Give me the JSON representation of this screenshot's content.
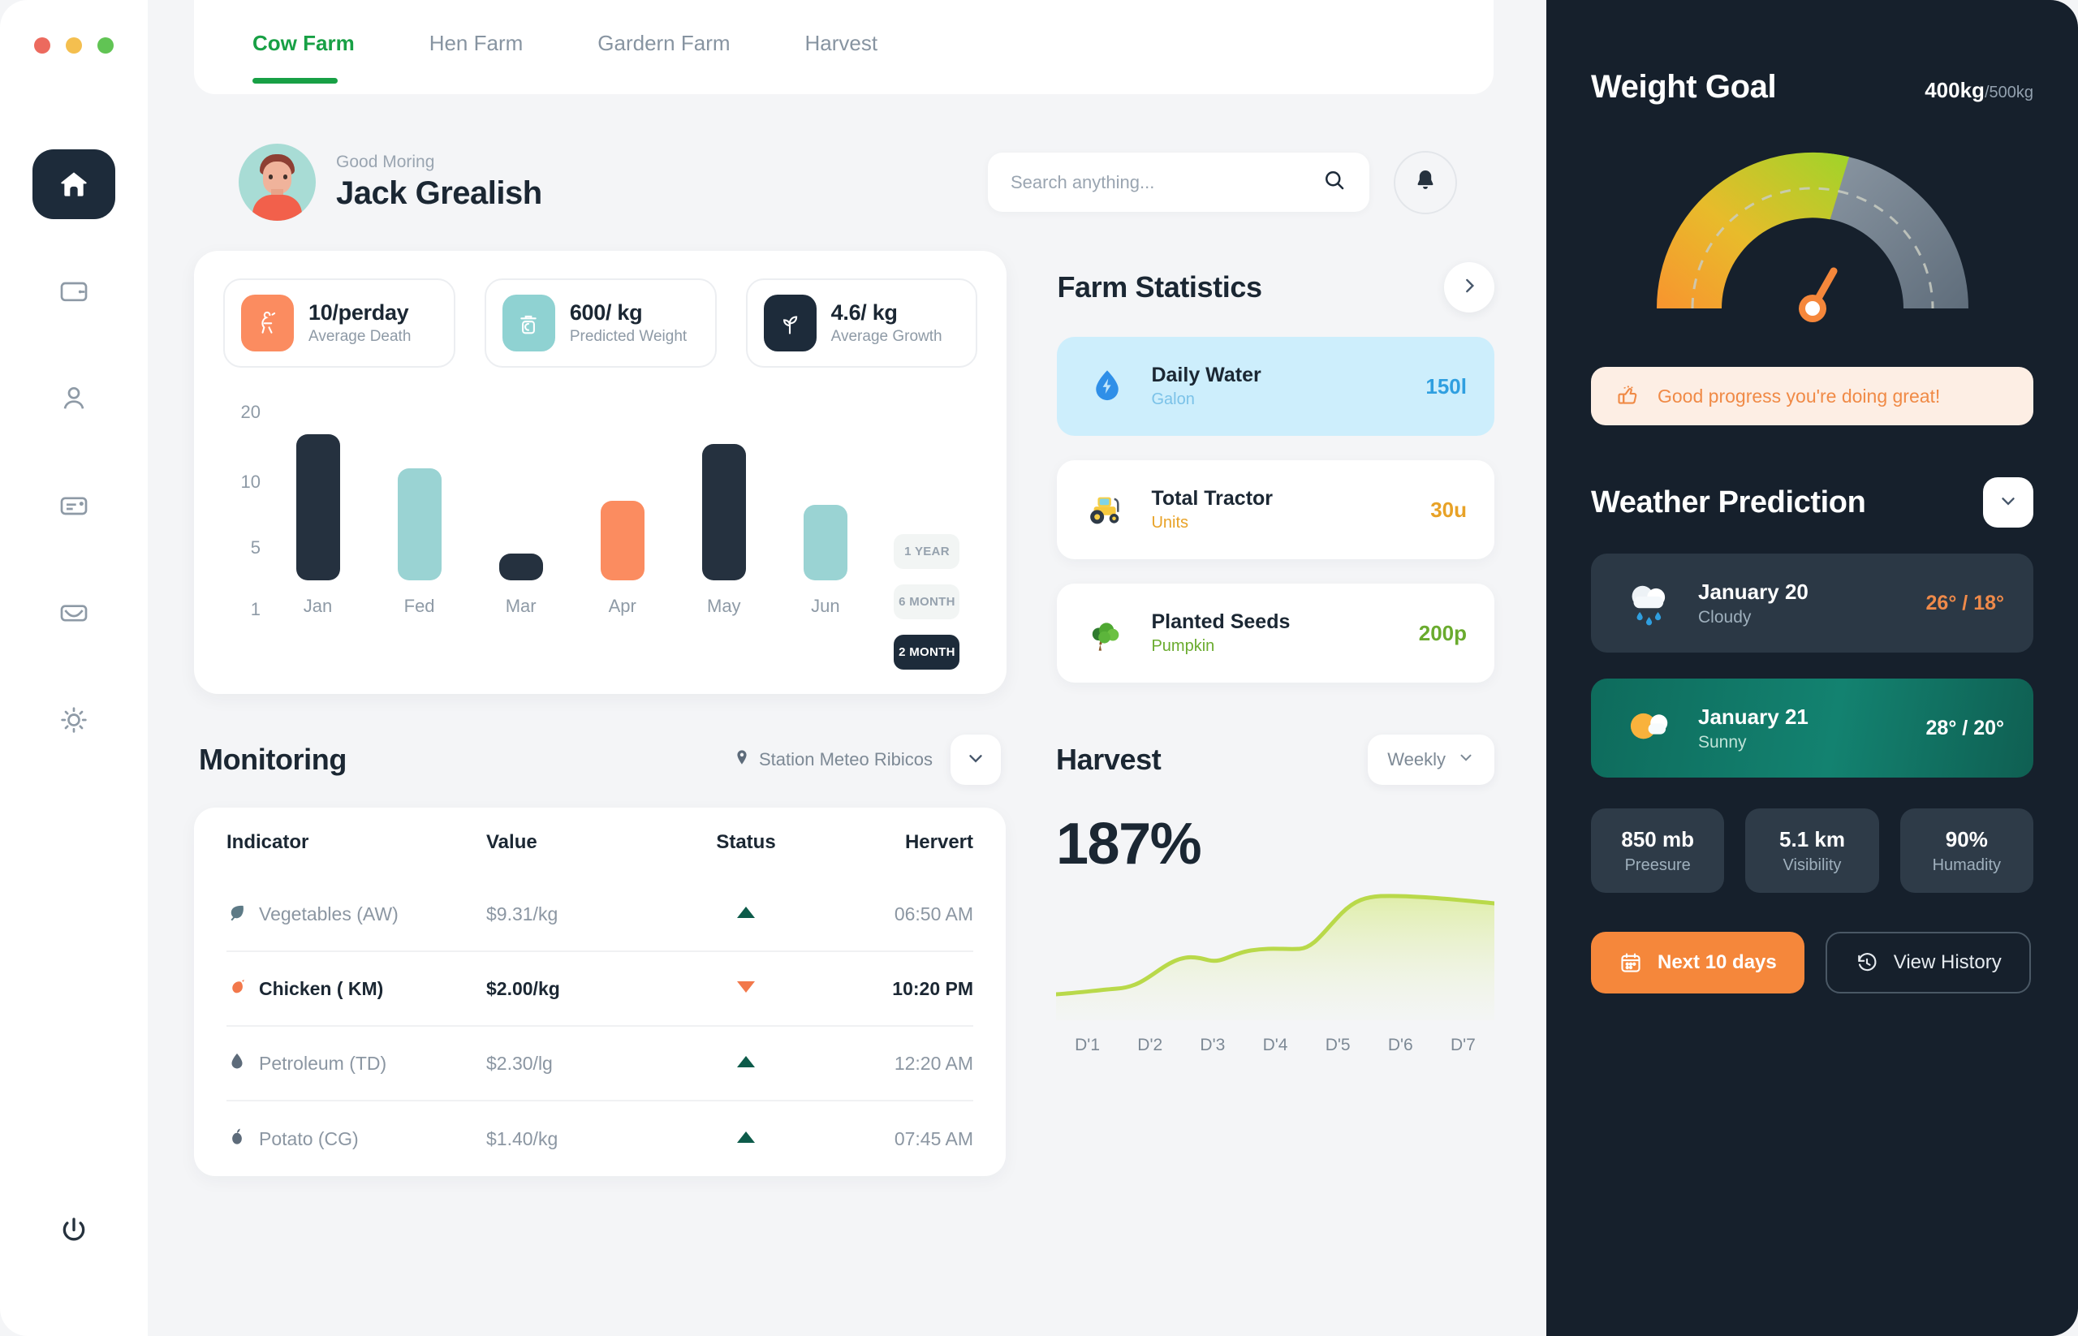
{
  "window": {
    "traffic_lights": [
      "close",
      "minimize",
      "maximize"
    ]
  },
  "sidebar": {
    "items": [
      {
        "icon": "home-icon",
        "active": true
      },
      {
        "icon": "wallet-icon",
        "active": false
      },
      {
        "icon": "user-icon",
        "active": false
      },
      {
        "icon": "card-message-icon",
        "active": false
      },
      {
        "icon": "envelope-icon",
        "active": false
      },
      {
        "icon": "brightness-sun-icon",
        "active": false
      }
    ],
    "power": "power-icon"
  },
  "tabs": [
    {
      "label": "Cow Farm",
      "active": true
    },
    {
      "label": "Hen Farm",
      "active": false
    },
    {
      "label": "Gardern Farm",
      "active": false
    },
    {
      "label": "Harvest",
      "active": false
    }
  ],
  "greeting": {
    "salutation": "Good Moring",
    "name": "Jack Grealish",
    "avatar": "user-avatar"
  },
  "search": {
    "placeholder": "Search anything...",
    "value": "",
    "icon": "search-icon"
  },
  "notifications": {
    "icon": "bell-icon"
  },
  "kpis": [
    {
      "value": "10/perday",
      "label": "Average Death",
      "icon": "chicken-icon",
      "color": "#fb8c60"
    },
    {
      "value": "600/ kg",
      "label": "Predicted Weight",
      "icon": "weight-scale-icon",
      "color": "#8fd2d2"
    },
    {
      "value": "4.6/ kg",
      "label": "Average Growth",
      "icon": "leaf-sprout-icon",
      "color": "#1d2b3a"
    }
  ],
  "chart_data": {
    "type": "bar",
    "title": "",
    "categories": [
      "Jan",
      "Fed",
      "Mar",
      "Apr",
      "May",
      "Jun"
    ],
    "values": [
      12,
      8.5,
      1.8,
      5.6,
      11.2,
      5.2
    ],
    "colors": [
      "#25313f",
      "#9ad3d3",
      "#25313f",
      "#fb8c60",
      "#25313f",
      "#9ad3d3"
    ],
    "ytick_labels": [
      "20",
      "10",
      "5",
      "1"
    ],
    "ytick_positions": [
      20,
      10,
      5,
      1
    ],
    "ylim": [
      0,
      20
    ],
    "xlabel": "",
    "ylabel": "",
    "grid": false,
    "legend": "none"
  },
  "chart_ranges": [
    {
      "label": "1 YEAR",
      "active": false
    },
    {
      "label": "6 MONTH",
      "active": false
    },
    {
      "label": "2 MONTH",
      "active": true
    }
  ],
  "farm_statistics": {
    "title": "Farm Statistics",
    "next_icon": "chevron-right-icon",
    "items": [
      {
        "name": "Daily Water",
        "sub": "Galon",
        "value": "150l",
        "icon": "water-drop-icon",
        "value_color": "#2f9fe0",
        "sub_color": "#7bc2e8",
        "card_bg": "#cdeefc"
      },
      {
        "name": "Total Tractor",
        "sub": "Units",
        "value": "30u",
        "icon": "tractor-icon",
        "value_color": "#e8a227",
        "sub_color": "#e8a227",
        "card_bg": "#ffffff"
      },
      {
        "name": "Planted Seeds",
        "sub": "Pumpkin",
        "value": "200p",
        "icon": "tree-icon",
        "value_color": "#6aab2e",
        "sub_color": "#6aab2e",
        "card_bg": "#ffffff"
      }
    ]
  },
  "monitoring": {
    "title": "Monitoring",
    "station": "Station Meteo Ribicos",
    "station_icon": "location-pin-icon",
    "caret_icon": "chevron-down-icon",
    "columns": [
      "Indicator",
      "Value",
      "Status",
      "Hervert"
    ],
    "rows": [
      {
        "indicator": "Vegetables (AW)",
        "icon": "leaf-icon",
        "value": "$9.31/kg",
        "status": "up",
        "hervert": "06:50 AM",
        "highlight": false
      },
      {
        "indicator": "Chicken ( KM)",
        "icon": "chicken-small-icon",
        "value": "$2.00/kg",
        "status": "down",
        "hervert": "10:20 PM",
        "highlight": true
      },
      {
        "indicator": "Petroleum (TD)",
        "icon": "oil-drop-icon",
        "value": "$2.30/lg",
        "status": "up",
        "hervert": "12:20 AM",
        "highlight": false
      },
      {
        "indicator": "Potato (CG)",
        "icon": "potato-icon",
        "value": "$1.40/kg",
        "status": "up",
        "hervert": "07:45 AM",
        "highlight": false
      }
    ]
  },
  "harvest": {
    "title": "Harvest",
    "period": "Weekly",
    "period_icon": "chevron-down-icon",
    "percent": "187%",
    "chart_data": {
      "type": "area",
      "x": [
        "D'1",
        "D'2",
        "D'3",
        "D'4",
        "D'5",
        "D'6",
        "D'7"
      ],
      "values": [
        18,
        22,
        40,
        46,
        52,
        86,
        82
      ],
      "line_color": "#b9d94a",
      "ylim": [
        0,
        100
      ],
      "grid": false
    }
  },
  "weight_goal": {
    "title": "Weight Goal",
    "current": "400kg",
    "target": "/500kg",
    "gauge": {
      "value": 400,
      "max": 500,
      "percent": 80
    },
    "progress_note": "Good progress you're doing great!",
    "progress_icon": "thumbs-up-icon"
  },
  "weather": {
    "title": "Weather Prediction",
    "caret_icon": "chevron-down-icon",
    "days": [
      {
        "date": "January 20",
        "condition": "Cloudy",
        "high": "26°",
        "sep": "/",
        "low": "18°",
        "icon": "rain-cloud-icon",
        "selected": false
      },
      {
        "date": "January 21",
        "condition": "Sunny",
        "high": "28°",
        "sep": "/",
        "low": "20°",
        "icon": "sun-cloud-icon",
        "selected": true
      }
    ],
    "metrics": [
      {
        "value": "850 mb",
        "label": "Preesure"
      },
      {
        "value": "5.1 km",
        "label": "Visibility"
      },
      {
        "value": "90%",
        "label": "Humadity"
      }
    ],
    "buttons": [
      {
        "label": "Next 10 days",
        "icon": "calendar-icon",
        "style": "primary"
      },
      {
        "label": "View History",
        "icon": "clock-rewind-icon",
        "style": "outline"
      }
    ]
  },
  "colors": {
    "accent_green": "#18a045",
    "accent_orange": "#f5873b",
    "dark": "#16202c",
    "teal": "#9ad3d3",
    "lime": "#b9d94a"
  }
}
